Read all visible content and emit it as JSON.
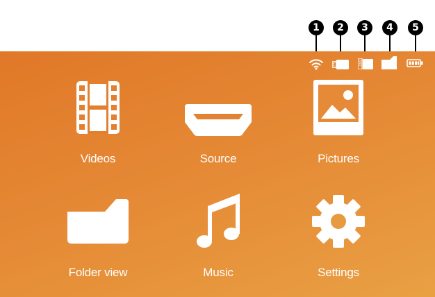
{
  "callouts": [
    "1",
    "2",
    "3",
    "4",
    "5"
  ],
  "status_bar": {
    "icons": [
      "wifi-icon",
      "usb-stick-icon",
      "sd-card-icon",
      "internal-memory-icon",
      "battery-icon"
    ]
  },
  "menu": {
    "items": [
      {
        "label": "Videos",
        "icon": "film-icon"
      },
      {
        "label": "Source",
        "icon": "hdmi-icon"
      },
      {
        "label": "Pictures",
        "icon": "picture-icon"
      },
      {
        "label": "Folder view",
        "icon": "folder-icon"
      },
      {
        "label": "Music",
        "icon": "music-note-icon"
      },
      {
        "label": "Settings",
        "icon": "gear-icon"
      }
    ]
  },
  "colors": {
    "background_start": "#e07828",
    "background_end": "#e9a043",
    "icon": "#ffffff",
    "callout": "#000000"
  }
}
